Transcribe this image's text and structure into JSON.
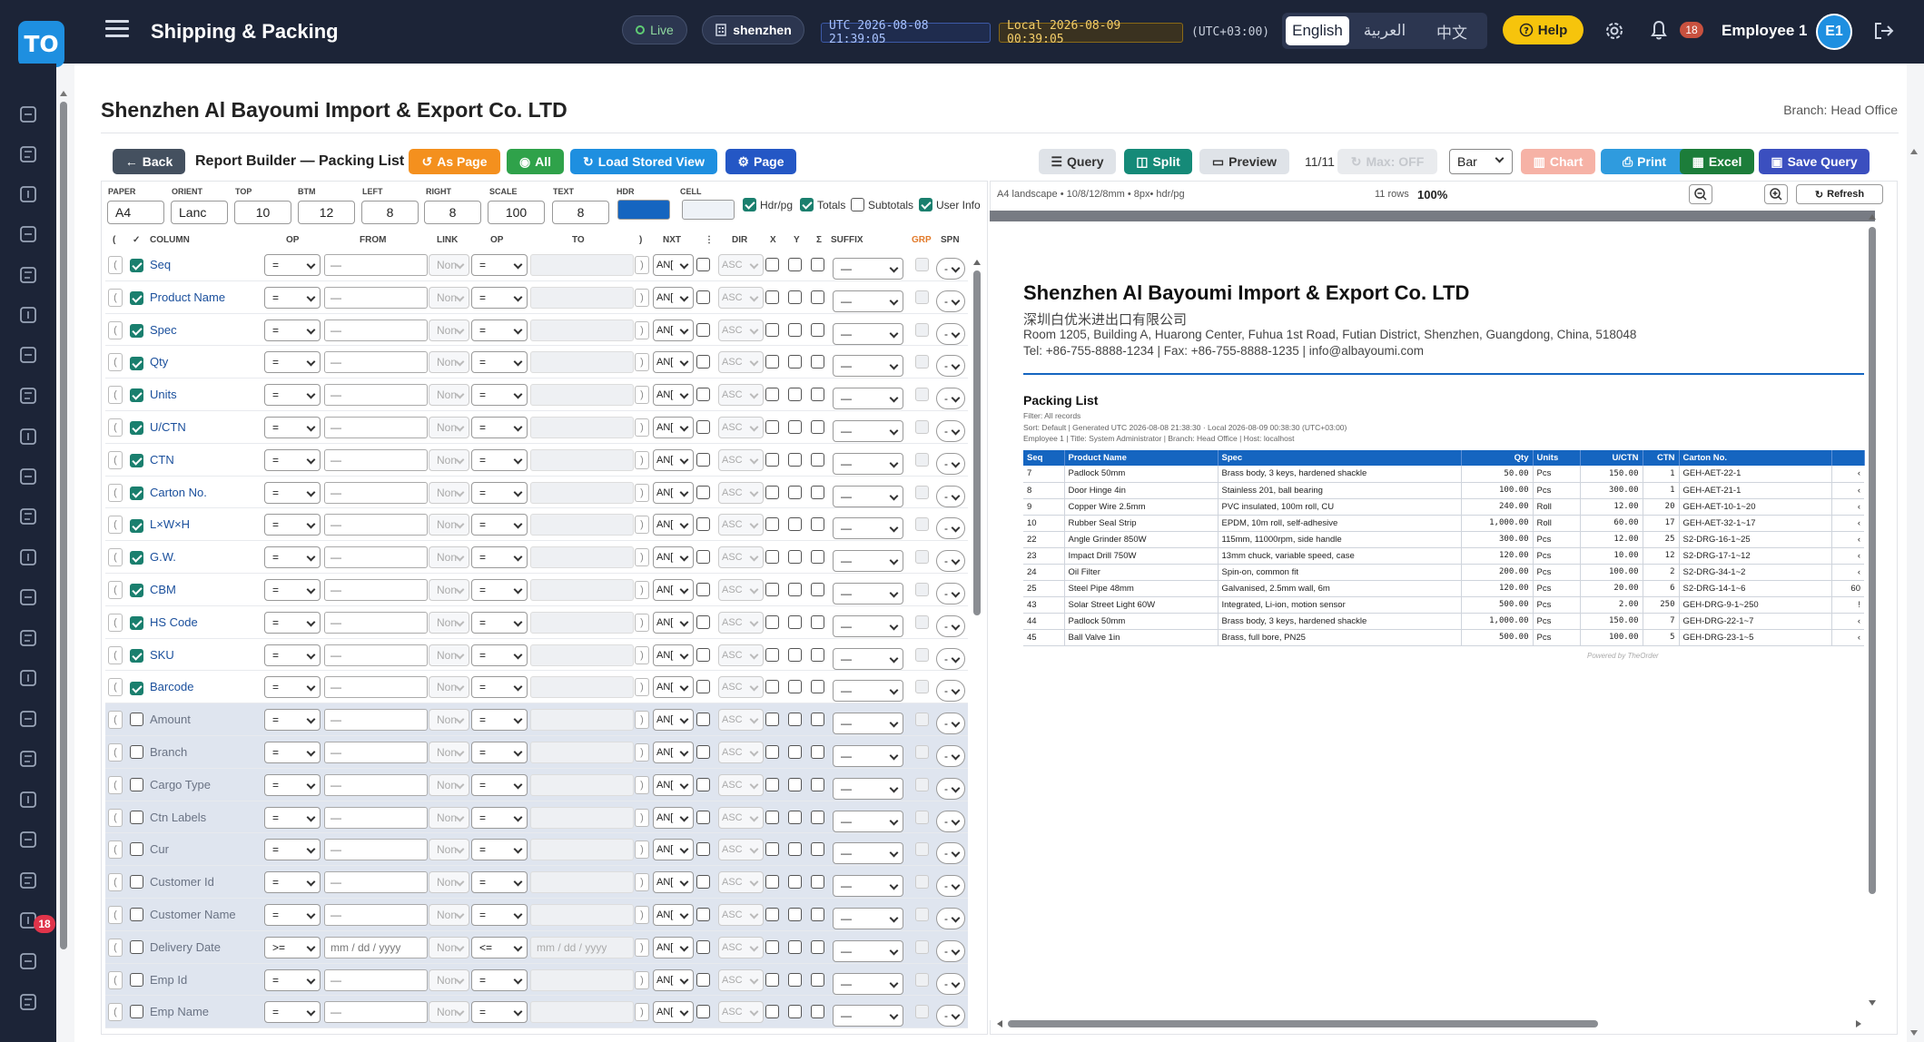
{
  "header": {
    "logo": "TO",
    "app_title": "Shipping & Packing",
    "live": "Live",
    "location": "shenzhen",
    "utc": "UTC 2026-08-08 21:39:05",
    "local": "Local 2026-08-09 00:39:05",
    "tz": "(UTC+03:00)",
    "langs": [
      "English",
      "العربية",
      "中文"
    ],
    "help": "Help",
    "notif_count": "18",
    "user": "Employee 1",
    "avatar": "E1"
  },
  "sidebar": {
    "icons": [
      "dashboard-icon",
      "clipboard-icon",
      "cart-icon",
      "clipboard-check-icon",
      "archive-icon",
      "box-icon",
      "layers-icon",
      "users-icon",
      "id-card-icon",
      "accessibility-icon",
      "truck-icon",
      "invoice-icon",
      "wallet-icon",
      "bank-icon",
      "document-icon",
      "book-icon",
      "dollar-icon",
      "chart-icon",
      "coins-icon",
      "inbox-icon",
      "megaphone-icon",
      "people-icon",
      "clock-icon"
    ],
    "badge": "18"
  },
  "page": {
    "company": "Shenzhen Al Bayoumi Import & Export Co. LTD",
    "branch": "Branch: Head Office"
  },
  "toolbar": {
    "back": "Back",
    "title": "Report Builder — Packing List",
    "as_page": "As Page",
    "all": "All",
    "load_view": "Load Stored View",
    "page": "Page",
    "query": "Query",
    "split": "Split",
    "preview": "Preview",
    "pager": "11/11",
    "max": "Max: OFF",
    "bar_option": "Bar",
    "chart": "Chart",
    "print": "Print",
    "excel": "Excel",
    "save_query": "Save Query"
  },
  "settings": {
    "paper_label": "PAPER",
    "paper": "A4",
    "orient_label": "ORIENT",
    "orient": "Lanc",
    "top_label": "TOP",
    "top": "10",
    "btm_label": "BTM",
    "btm": "12",
    "left_label": "LEFT",
    "left": "8",
    "right_label": "RIGHT",
    "right": "8",
    "scale_label": "SCALE",
    "scale": "100",
    "text_label": "TEXT",
    "text": "8",
    "hdr_label": "HDR",
    "hdr_color": "#1565c0",
    "cell_label": "CELL",
    "cell_color": "#eef2f7",
    "hdrpg": "Hdr/pg",
    "totals": "Totals",
    "subtotals": "Subtotals",
    "userinfo": "User Info"
  },
  "columns_header": {
    "paren_open": "(",
    "check": "✓",
    "column": "COLUMN",
    "op": "OP",
    "from": "FROM",
    "link": "LINK",
    "op2": "OP",
    "to": "TO",
    "paren_close": ")",
    "nxt": "NXT",
    "move": "⋮",
    "dir": "DIR",
    "x": "X",
    "y": "Y",
    "sigma": "Σ",
    "suffix": "SUFFIX",
    "grp": "GRP",
    "spn": "SPN"
  },
  "columns": [
    {
      "name": "Seq",
      "on": true
    },
    {
      "name": "Product Name",
      "on": true
    },
    {
      "name": "Spec",
      "on": true
    },
    {
      "name": "Qty",
      "on": true
    },
    {
      "name": "Units",
      "on": true
    },
    {
      "name": "U/CTN",
      "on": true
    },
    {
      "name": "CTN",
      "on": true
    },
    {
      "name": "Carton No.",
      "on": true
    },
    {
      "name": "L×W×H",
      "on": true
    },
    {
      "name": "G.W.",
      "on": true
    },
    {
      "name": "CBM",
      "on": true
    },
    {
      "name": "HS Code",
      "on": true
    },
    {
      "name": "SKU",
      "on": true
    },
    {
      "name": "Barcode",
      "on": true
    },
    {
      "name": "Amount",
      "on": false
    },
    {
      "name": "Branch",
      "on": false
    },
    {
      "name": "Cargo Type",
      "on": false
    },
    {
      "name": "Ctn Labels",
      "on": false
    },
    {
      "name": "Cur",
      "on": false
    },
    {
      "name": "Customer Id",
      "on": false
    },
    {
      "name": "Customer Name",
      "on": false
    },
    {
      "name": "Delivery Date",
      "on": false,
      "date": true
    },
    {
      "name": "Emp Id",
      "on": false
    },
    {
      "name": "Emp Name",
      "on": false
    }
  ],
  "row_defaults": {
    "op": "=",
    "from": "—",
    "link": "Non",
    "to": "",
    "nxt": "AN[",
    "dir": "ASC",
    "suffix": "—",
    "spn": "-",
    "date_op1": ">=",
    "date_op2": "<=",
    "date_placeholder": "mm / dd / yyyy"
  },
  "preview": {
    "info": "A4 landscape • 10/8/12/8mm • 8px• hdr/pg",
    "rows": "11 rows",
    "zoom": "100%",
    "refresh": "Refresh",
    "company": "Shenzhen Al Bayoumi Import & Export Co. LTD",
    "company_cn": "深圳白优米进出口有限公司",
    "address": "Room 1205, Building A, Huarong Center, Fuhua 1st Road, Futian District, Shenzhen, Guangdong, China, 518048",
    "tel": "Tel: +86-755-8888-1234 | Fax: +86-755-8888-1235 | info@albayoumi.com",
    "list_title": "Packing List",
    "meta1": "Filter: All records",
    "meta2": "Sort: Default | Generated UTC 2026-08-08 21:38:30 · Local 2026-08-09 00:38:30 (UTC+03:00)",
    "meta3": "Employee 1 | Title: System Administrator | Branch: Head Office | Host: localhost",
    "footer": "Powered by TheOrder",
    "table": {
      "headers": [
        "Seq",
        "Product Name",
        "Spec",
        "Qty",
        "Units",
        "U/CTN",
        "CTN",
        "Carton No.",
        ""
      ],
      "rows": [
        [
          "7",
          "Padlock 50mm",
          "Brass body, 3 keys, hardened shackle",
          "50.00",
          "Pcs",
          "150.00",
          "1",
          "GEH-AET-22-1",
          "‹"
        ],
        [
          "8",
          "Door Hinge 4in",
          "Stainless 201, ball bearing",
          "100.00",
          "Pcs",
          "300.00",
          "1",
          "GEH-AET-21-1",
          "‹"
        ],
        [
          "9",
          "Copper Wire 2.5mm",
          "PVC insulated, 100m roll, CU",
          "240.00",
          "Roll",
          "12.00",
          "20",
          "GEH-AET-10-1~20",
          "‹"
        ],
        [
          "10",
          "Rubber Seal Strip",
          "EPDM, 10m roll, self-adhesive",
          "1,000.00",
          "Roll",
          "60.00",
          "17",
          "GEH-AET-32-1~17",
          "‹"
        ],
        [
          "22",
          "Angle Grinder 850W",
          "115mm, 11000rpm, side handle",
          "300.00",
          "Pcs",
          "12.00",
          "25",
          "S2-DRG-16-1~25",
          "‹"
        ],
        [
          "23",
          "Impact Drill 750W",
          "13mm chuck, variable speed, case",
          "120.00",
          "Pcs",
          "10.00",
          "12",
          "S2-DRG-17-1~12",
          "‹"
        ],
        [
          "24",
          "Oil Filter",
          "Spin-on, common fit",
          "200.00",
          "Pcs",
          "100.00",
          "2",
          "S2-DRG-34-1~2",
          "‹"
        ],
        [
          "25",
          "Steel Pipe 48mm",
          "Galvanised, 2.5mm wall, 6m",
          "120.00",
          "Pcs",
          "20.00",
          "6",
          "S2-DRG-14-1~6",
          "60"
        ],
        [
          "43",
          "Solar Street Light 60W",
          "Integrated, Li-ion, motion sensor",
          "500.00",
          "Pcs",
          "2.00",
          "250",
          "GEH-DRG-9-1~250",
          "!"
        ],
        [
          "44",
          "Padlock 50mm",
          "Brass body, 3 keys, hardened shackle",
          "1,000.00",
          "Pcs",
          "150.00",
          "7",
          "GEH-DRG-22-1~7",
          "‹"
        ],
        [
          "45",
          "Ball Valve 1in",
          "Brass, full bore, PN25",
          "500.00",
          "Pcs",
          "100.00",
          "5",
          "GEH-DRG-23-1~5",
          "‹"
        ]
      ]
    }
  }
}
